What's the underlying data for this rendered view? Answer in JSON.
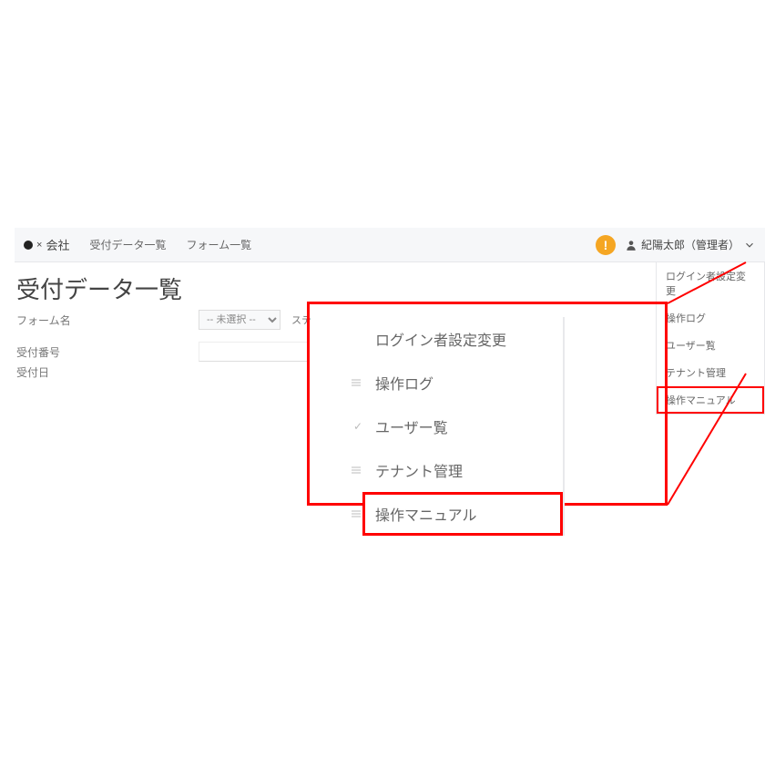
{
  "topbar": {
    "brand_suffix": "会社",
    "nav": [
      "受付データ一覧",
      "フォーム一覧"
    ],
    "notif_glyph": "!",
    "user_name": "紀陽太郎（管理者）"
  },
  "page_title": "受付データ一覧",
  "form": {
    "row1_label": "フォーム名",
    "row1_select_value": "-- 未選択 --",
    "row1_status_label": "ステ",
    "row2_label": "受付番号",
    "row3_label": "受付日"
  },
  "user_menu": [
    "ログイン者設定変更",
    "操作ログ",
    "ユーザー覧",
    "テナント管理",
    "操作マニュアル"
  ],
  "zoom_menu": [
    "ログイン者設定変更",
    "操作ログ",
    "ユーザー覧",
    "テナント管理",
    "操作マニュアル"
  ]
}
